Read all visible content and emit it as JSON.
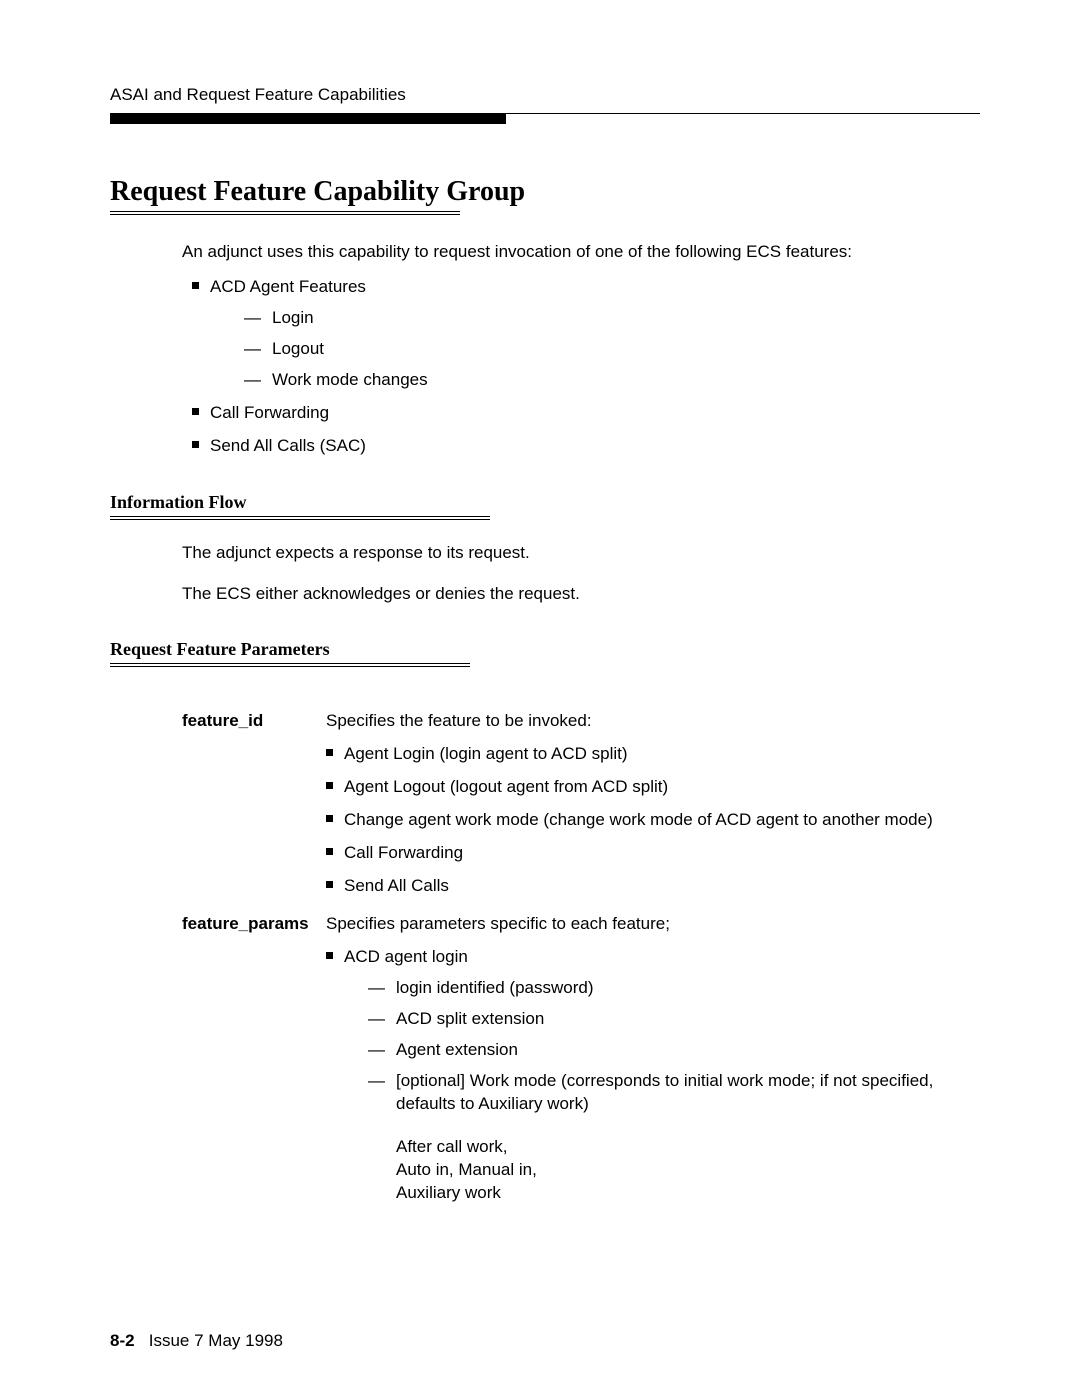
{
  "running_head": "ASAI and Request Feature Capabilities",
  "title": "Request Feature Capability Group",
  "intro": "An adjunct uses this capability to request invocation of one of the following ECS features:",
  "features": {
    "acd_label": "ACD Agent Features",
    "acd_sub": [
      "Login",
      "Logout",
      "Work mode changes"
    ],
    "call_fwd": "Call Forwarding",
    "sac": "Send All Calls (SAC)"
  },
  "info_flow": {
    "heading": "Information Flow",
    "p1": "The adjunct expects a response to its request.",
    "p2": "The ECS either acknowledges or denies the request."
  },
  "params": {
    "heading": "Request Feature Parameters",
    "feature_id": {
      "label": "feature_id",
      "desc": "Specifies the feature to be invoked:",
      "items": [
        "Agent Login (login agent to ACD split)",
        "Agent Logout (logout agent from ACD split)",
        "Change agent work mode (change work mode of ACD agent to another mode)",
        "Call Forwarding",
        "Send All Calls"
      ]
    },
    "feature_params": {
      "label": "feature_params",
      "desc": "Specifies parameters specific to each feature;",
      "acd_login_label": "ACD agent login",
      "acd_login_sub": [
        "login identified (password)",
        "ACD split extension",
        "Agent extension",
        "[optional] Work mode (corresponds to initial work mode; if not specified, defaults to Auxiliary work)"
      ],
      "work_mode_lines": [
        "After call work,",
        "Auto in, Manual in,",
        "Auxiliary work"
      ]
    }
  },
  "footer": {
    "page": "8-2",
    "issue": "Issue  7 May 1998"
  }
}
